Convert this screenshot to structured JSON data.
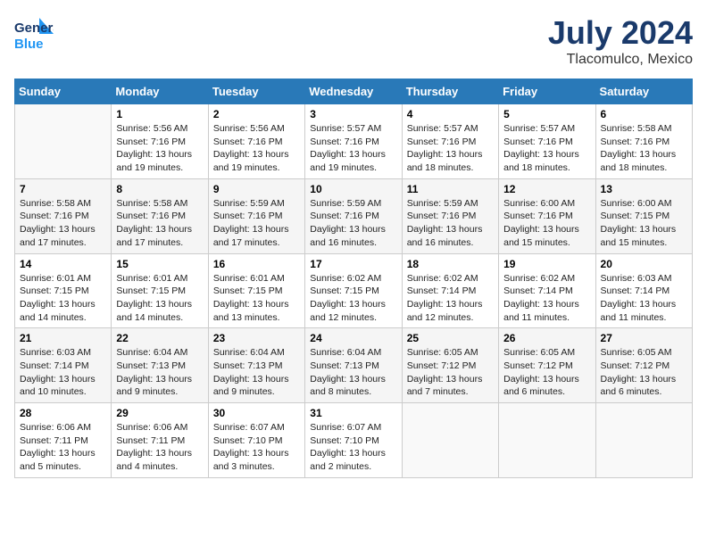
{
  "header": {
    "logo_line1": "General",
    "logo_line2": "Blue",
    "month_year": "July 2024",
    "location": "Tlacomulco, Mexico"
  },
  "weekdays": [
    "Sunday",
    "Monday",
    "Tuesday",
    "Wednesday",
    "Thursday",
    "Friday",
    "Saturday"
  ],
  "weeks": [
    [
      {
        "day": "",
        "info": ""
      },
      {
        "day": "1",
        "info": "Sunrise: 5:56 AM\nSunset: 7:16 PM\nDaylight: 13 hours\nand 19 minutes."
      },
      {
        "day": "2",
        "info": "Sunrise: 5:56 AM\nSunset: 7:16 PM\nDaylight: 13 hours\nand 19 minutes."
      },
      {
        "day": "3",
        "info": "Sunrise: 5:57 AM\nSunset: 7:16 PM\nDaylight: 13 hours\nand 19 minutes."
      },
      {
        "day": "4",
        "info": "Sunrise: 5:57 AM\nSunset: 7:16 PM\nDaylight: 13 hours\nand 18 minutes."
      },
      {
        "day": "5",
        "info": "Sunrise: 5:57 AM\nSunset: 7:16 PM\nDaylight: 13 hours\nand 18 minutes."
      },
      {
        "day": "6",
        "info": "Sunrise: 5:58 AM\nSunset: 7:16 PM\nDaylight: 13 hours\nand 18 minutes."
      }
    ],
    [
      {
        "day": "7",
        "info": "Sunrise: 5:58 AM\nSunset: 7:16 PM\nDaylight: 13 hours\nand 17 minutes."
      },
      {
        "day": "8",
        "info": "Sunrise: 5:58 AM\nSunset: 7:16 PM\nDaylight: 13 hours\nand 17 minutes."
      },
      {
        "day": "9",
        "info": "Sunrise: 5:59 AM\nSunset: 7:16 PM\nDaylight: 13 hours\nand 17 minutes."
      },
      {
        "day": "10",
        "info": "Sunrise: 5:59 AM\nSunset: 7:16 PM\nDaylight: 13 hours\nand 16 minutes."
      },
      {
        "day": "11",
        "info": "Sunrise: 5:59 AM\nSunset: 7:16 PM\nDaylight: 13 hours\nand 16 minutes."
      },
      {
        "day": "12",
        "info": "Sunrise: 6:00 AM\nSunset: 7:16 PM\nDaylight: 13 hours\nand 15 minutes."
      },
      {
        "day": "13",
        "info": "Sunrise: 6:00 AM\nSunset: 7:15 PM\nDaylight: 13 hours\nand 15 minutes."
      }
    ],
    [
      {
        "day": "14",
        "info": "Sunrise: 6:01 AM\nSunset: 7:15 PM\nDaylight: 13 hours\nand 14 minutes."
      },
      {
        "day": "15",
        "info": "Sunrise: 6:01 AM\nSunset: 7:15 PM\nDaylight: 13 hours\nand 14 minutes."
      },
      {
        "day": "16",
        "info": "Sunrise: 6:01 AM\nSunset: 7:15 PM\nDaylight: 13 hours\nand 13 minutes."
      },
      {
        "day": "17",
        "info": "Sunrise: 6:02 AM\nSunset: 7:15 PM\nDaylight: 13 hours\nand 12 minutes."
      },
      {
        "day": "18",
        "info": "Sunrise: 6:02 AM\nSunset: 7:14 PM\nDaylight: 13 hours\nand 12 minutes."
      },
      {
        "day": "19",
        "info": "Sunrise: 6:02 AM\nSunset: 7:14 PM\nDaylight: 13 hours\nand 11 minutes."
      },
      {
        "day": "20",
        "info": "Sunrise: 6:03 AM\nSunset: 7:14 PM\nDaylight: 13 hours\nand 11 minutes."
      }
    ],
    [
      {
        "day": "21",
        "info": "Sunrise: 6:03 AM\nSunset: 7:14 PM\nDaylight: 13 hours\nand 10 minutes."
      },
      {
        "day": "22",
        "info": "Sunrise: 6:04 AM\nSunset: 7:13 PM\nDaylight: 13 hours\nand 9 minutes."
      },
      {
        "day": "23",
        "info": "Sunrise: 6:04 AM\nSunset: 7:13 PM\nDaylight: 13 hours\nand 9 minutes."
      },
      {
        "day": "24",
        "info": "Sunrise: 6:04 AM\nSunset: 7:13 PM\nDaylight: 13 hours\nand 8 minutes."
      },
      {
        "day": "25",
        "info": "Sunrise: 6:05 AM\nSunset: 7:12 PM\nDaylight: 13 hours\nand 7 minutes."
      },
      {
        "day": "26",
        "info": "Sunrise: 6:05 AM\nSunset: 7:12 PM\nDaylight: 13 hours\nand 6 minutes."
      },
      {
        "day": "27",
        "info": "Sunrise: 6:05 AM\nSunset: 7:12 PM\nDaylight: 13 hours\nand 6 minutes."
      }
    ],
    [
      {
        "day": "28",
        "info": "Sunrise: 6:06 AM\nSunset: 7:11 PM\nDaylight: 13 hours\nand 5 minutes."
      },
      {
        "day": "29",
        "info": "Sunrise: 6:06 AM\nSunset: 7:11 PM\nDaylight: 13 hours\nand 4 minutes."
      },
      {
        "day": "30",
        "info": "Sunrise: 6:07 AM\nSunset: 7:10 PM\nDaylight: 13 hours\nand 3 minutes."
      },
      {
        "day": "31",
        "info": "Sunrise: 6:07 AM\nSunset: 7:10 PM\nDaylight: 13 hours\nand 2 minutes."
      },
      {
        "day": "",
        "info": ""
      },
      {
        "day": "",
        "info": ""
      },
      {
        "day": "",
        "info": ""
      }
    ]
  ]
}
